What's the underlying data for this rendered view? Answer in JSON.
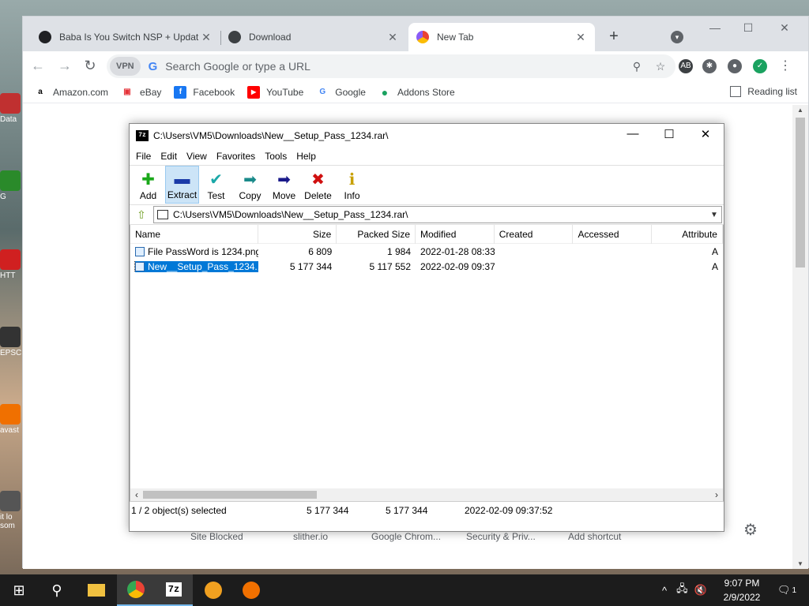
{
  "desktop": {
    "icons": [
      {
        "label": "Data",
        "color": "#c03030"
      },
      {
        "label": "G",
        "color": "#2a8a2a"
      },
      {
        "label": "HTT",
        "color": "#d02020"
      },
      {
        "label": "EPSC",
        "color": "#333333"
      },
      {
        "label": "avast",
        "color": "#f07000"
      },
      {
        "label": "it lo som",
        "color": "#555555"
      }
    ]
  },
  "browser": {
    "tabs": [
      {
        "title": "Baba Is You Switch NSP + Updat",
        "close": "✕"
      },
      {
        "title": "Download",
        "close": "✕"
      },
      {
        "title": "New Tab",
        "close": "✕"
      }
    ],
    "new_tab_icon": "+",
    "window_controls": {
      "minimize": "—",
      "maximize": "☐",
      "close": "✕"
    },
    "nav": {
      "back": "←",
      "forward": "→",
      "reload": "↻"
    },
    "omnibox": {
      "vpn": "VPN",
      "g": "G",
      "placeholder": "Search Google or type a URL",
      "location_icon": "⚲",
      "star_icon": "☆"
    },
    "bookmarks": [
      {
        "label": "Amazon.com",
        "icon": "a",
        "color": "#000000"
      },
      {
        "label": "eBay",
        "icon": "▣",
        "color": "#e53238"
      },
      {
        "label": "Facebook",
        "icon": "f",
        "color": "#1877f2"
      },
      {
        "label": "YouTube",
        "icon": "▶",
        "color": "#ff0000"
      },
      {
        "label": "Google",
        "icon": "G",
        "color": "#4285f4"
      },
      {
        "label": "Addons Store",
        "icon": "●",
        "color": "#1aa260"
      }
    ],
    "reading_list": "Reading list",
    "shortcuts": [
      "Site Blocked",
      "slither.io",
      "Google Chrom...",
      "Security & Priv...",
      "Add shortcut"
    ]
  },
  "zip": {
    "logo": "7z",
    "title": "C:\\Users\\VM5\\Downloads\\New__Setup_Pass_1234.rar\\",
    "menu": [
      "File",
      "Edit",
      "View",
      "Favorites",
      "Tools",
      "Help"
    ],
    "tools": [
      {
        "label": "Add",
        "glyph": "✚",
        "color": "#1aa81a"
      },
      {
        "label": "Extract",
        "glyph": "▬",
        "color": "#1a3aa8"
      },
      {
        "label": "Test",
        "glyph": "✔",
        "color": "#1aa8a8"
      },
      {
        "label": "Copy",
        "glyph": "➡",
        "color": "#1a8a8a"
      },
      {
        "label": "Move",
        "glyph": "➡",
        "color": "#1a1a8a"
      },
      {
        "label": "Delete",
        "glyph": "✖",
        "color": "#d01010"
      },
      {
        "label": "Info",
        "glyph": "ℹ",
        "color": "#c8a000"
      }
    ],
    "address": "C:\\Users\\VM5\\Downloads\\New__Setup_Pass_1234.rar\\",
    "columns": [
      "Name",
      "Size",
      "Packed Size",
      "Modified",
      "Created",
      "Accessed",
      "Attribute"
    ],
    "rows": [
      {
        "name": "File PassWord is 1234.png",
        "size": "6 809",
        "packed": "1 984",
        "modified": "2022-01-28 08:33",
        "created": "",
        "accessed": "",
        "attr": "A"
      },
      {
        "name": "New__Setup_Pass_1234....",
        "size": "5 177 344",
        "packed": "5 117 552",
        "modified": "2022-02-09 09:37",
        "created": "",
        "accessed": "",
        "attr": "A"
      }
    ],
    "status": {
      "selected": "1 / 2 object(s) selected",
      "size": "5 177 344",
      "packed": "5 177 344",
      "modified": "2022-02-09 09:37:52"
    }
  },
  "taskbar": {
    "clock_time": "9:07 PM",
    "clock_date": "2/9/2022",
    "notification_count": "1"
  }
}
